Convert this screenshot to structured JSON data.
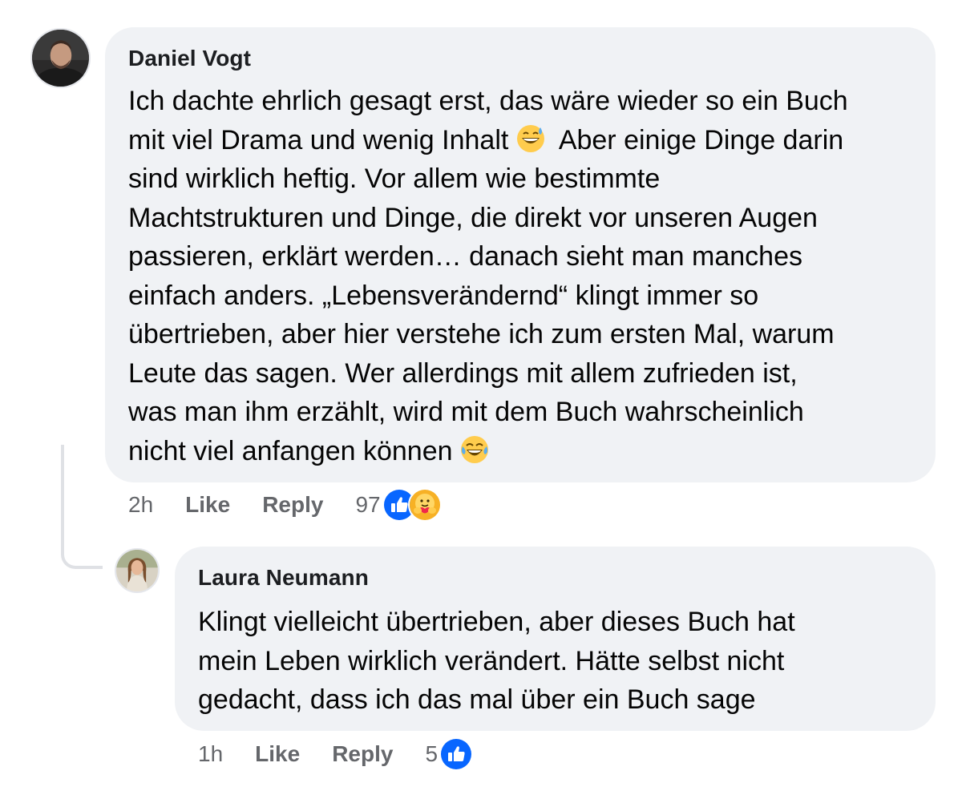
{
  "comment": {
    "author": "Daniel Vogt",
    "lines": [
      "Ich dachte ehrlich gesagt erst, das wäre wieder so ein Buch",
      "mit viel Drama und wenig Inhalt",
      "Aber einige Dinge darin",
      "sind wirklich heftig. Vor allem wie bestimmte",
      "Machtstrukturen und Dinge, die direkt vor unseren Augen",
      "passieren, erklärt werden… danach sieht man manches",
      "einfach anders. „Lebensverändernd“ klingt immer so",
      "übertrieben, aber hier verstehe ich zum ersten Mal, warum",
      "Leute das sagen. Wer allerdings mit allem zufrieden ist,",
      "was man ihm erzählt, wird mit dem Buch wahrscheinlich",
      "nicht viel anfangen können"
    ],
    "emojis": [
      "grinning-sweat-emoji",
      "tears-of-joy-emoji"
    ],
    "time": "2h",
    "like_label": "Like",
    "reply_label": "Reply",
    "reaction_count": "97",
    "reactions": [
      "like-reaction-icon",
      "care-reaction-icon"
    ]
  },
  "reply": {
    "author": "Laura Neumann",
    "lines": [
      "Klingt vielleicht übertrieben, aber dieses Buch hat",
      "mein Leben wirklich verändert. Hätte selbst nicht",
      "gedacht, dass ich das mal über ein Buch sage"
    ],
    "time": "1h",
    "like_label": "Like",
    "reply_label": "Reply",
    "reaction_count": "5",
    "reactions": [
      "like-reaction-icon"
    ]
  },
  "colors": {
    "bubble": "#f0f2f5",
    "meta_text": "#65676b",
    "like_blue": "#0866ff",
    "thread_line": "#dfe1e5"
  }
}
